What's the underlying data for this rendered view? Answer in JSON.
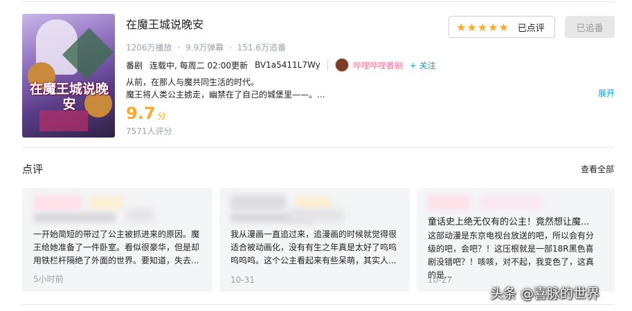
{
  "anime": {
    "title": "在魔王城说晚安",
    "cover_text": "在魔王城说晚安",
    "stats": [
      "1206万播放",
      "·",
      "9.9万弹幕",
      "·",
      "151.6万追番"
    ],
    "meta": {
      "type": "番剧",
      "schedule": "连载中, 每周二 02:00更新",
      "bvid": "BV1a5411L7Wy",
      "publisher": "哔哩哔哩番剧",
      "follow_label": "+ 关注"
    },
    "desc_line1": "从前，在那人与魔共同生活的时代。",
    "desc_line2": "魔王将人类公主掳走，幽禁在了自己的城堡里——。...",
    "expand_label": "展开",
    "score": "9.7",
    "score_unit": "分",
    "rating_count": "7571人评分",
    "rate_button": {
      "stars": "★★★★★",
      "label": "已点评"
    },
    "follow_button_label": "已追番"
  },
  "reviews": {
    "section_title": "点评",
    "view_all_label": "查看全部",
    "items": [
      {
        "text": "一开始简短的带过了公主被抓进来的原因。魔王给她准备了一件卧室。看似很豪华，但是却用铁栏杆隔绝了外面的世界。要知道，失去...",
        "date": "5小时前"
      },
      {
        "text": "我从漫画一直追过来，追漫画的时候就觉得很适合被动画化，没有有生之年真是太好了呜呜呜呜呜。这个公主看起来有些呆萌，其实人...",
        "date": "10-31"
      },
      {
        "headline": "童话史上绝无仅有的公主！竟然想让魔...",
        "text": "这部动漫是东京电视台放送的吧，所以会有分级的吧，会吧？！这压根就是一部18R黑色喜剧没错吧？！咳咳，对不起，我变色了，这真的是...",
        "date": "10-27"
      }
    ]
  },
  "watermark": "头条 @喜脉的世界",
  "colors": {
    "accent": "#00a1d6",
    "pink": "#fb7299",
    "score": "#ffa726"
  }
}
